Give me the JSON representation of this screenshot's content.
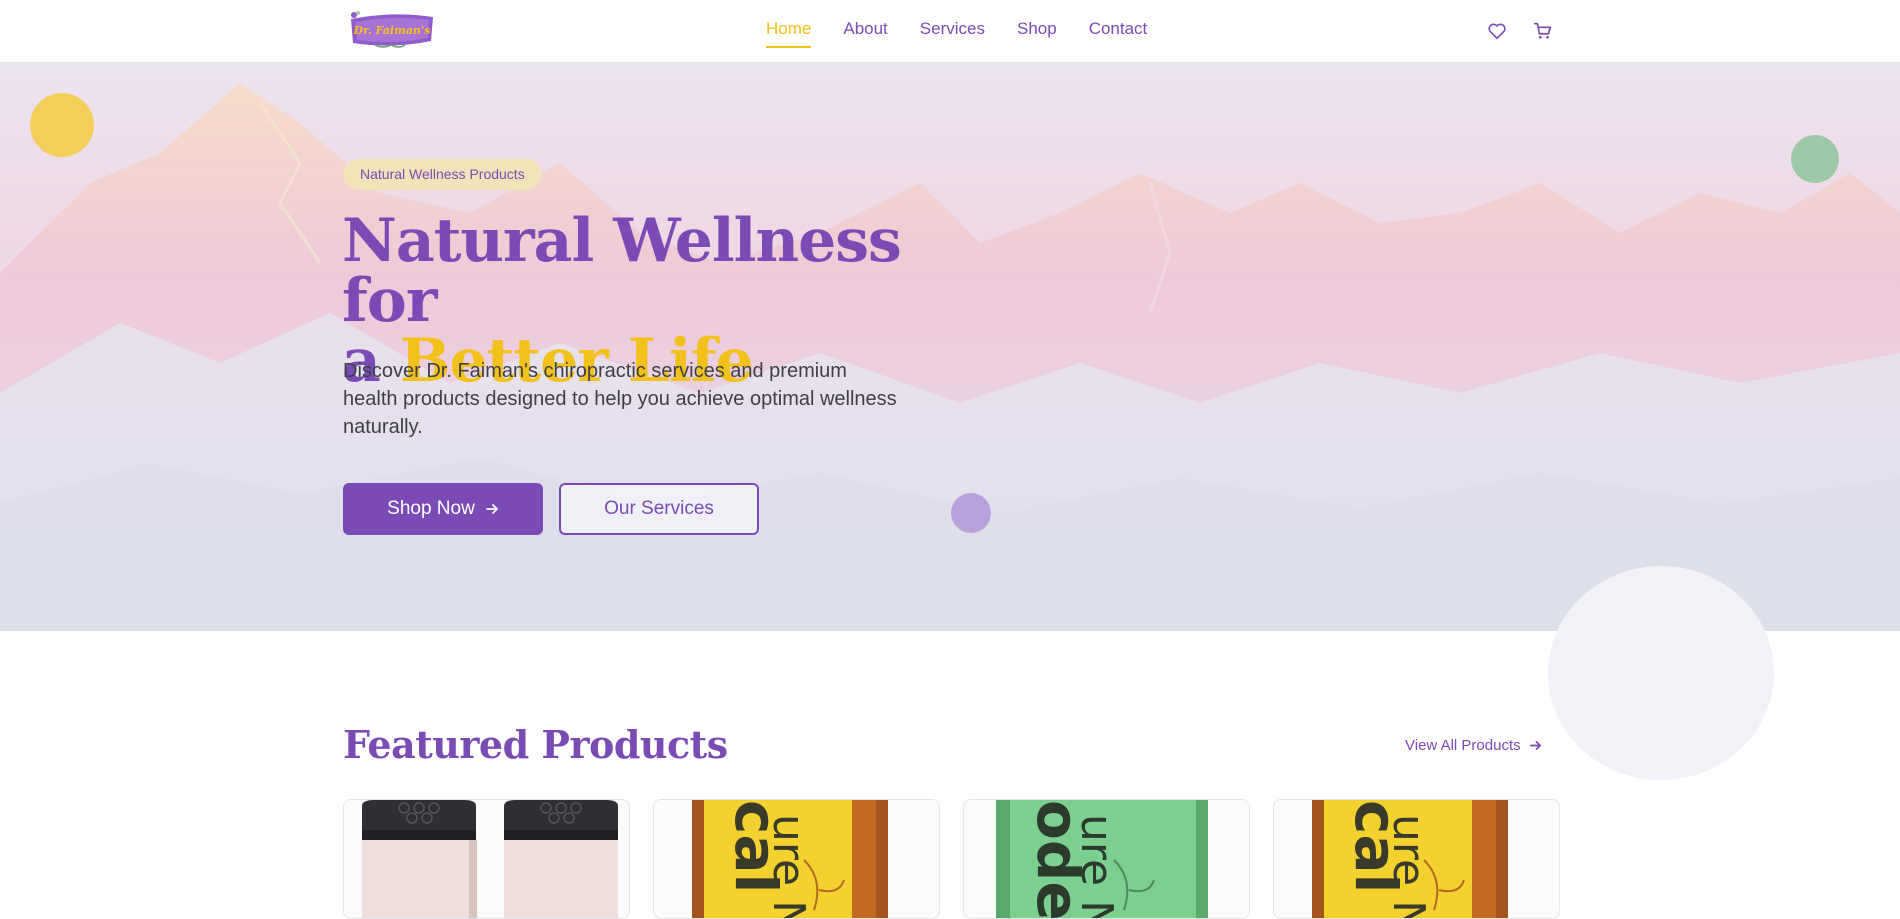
{
  "brand": {
    "logo_text": "Dr. Faiman's"
  },
  "nav": {
    "links": [
      {
        "label": "Home",
        "active": true
      },
      {
        "label": "About"
      },
      {
        "label": "Services"
      },
      {
        "label": "Shop"
      },
      {
        "label": "Contact"
      }
    ],
    "icons": [
      "heart-icon",
      "cart-icon"
    ]
  },
  "hero": {
    "badge": "Natural Wellness Products",
    "title_line1": "Natural Wellness for",
    "title_prefix": "a ",
    "title_accent": "Better Life",
    "description": "Discover Dr. Faiman's chiropractic services and premium health products designed to help you achieve optimal wellness naturally.",
    "primary_button": "Shop Now",
    "secondary_button": "Our Services"
  },
  "featured": {
    "title": "Featured Products",
    "view_all": "View All Products",
    "products": [
      {
        "image": "salt-shaker-jars"
      },
      {
        "image": "yellow-calm-label"
      },
      {
        "image": "green-label-jar"
      },
      {
        "image": "yellow-calm-label"
      }
    ]
  },
  "colors": {
    "primary": "#7b4bb5",
    "accent": "#f2c21b",
    "text": "#3f3f46",
    "green_dot": "#9ccaa6",
    "purple_dot": "#b9a2dc"
  }
}
